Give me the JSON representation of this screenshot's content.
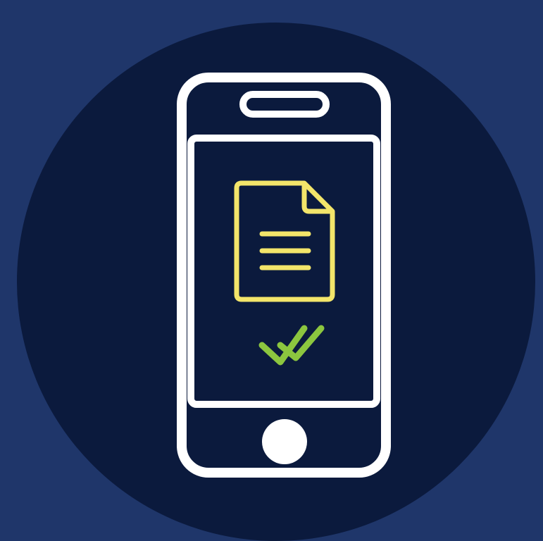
{
  "colors": {
    "background": "#1f366a",
    "circle": "#0b1a3d",
    "phone_outline": "#ffffff",
    "document": "#f3e56a",
    "checkmark": "#8cc63f"
  },
  "icons": {
    "phone": "smartphone-icon",
    "document": "document-icon",
    "checkmark": "double-checkmark-icon"
  }
}
